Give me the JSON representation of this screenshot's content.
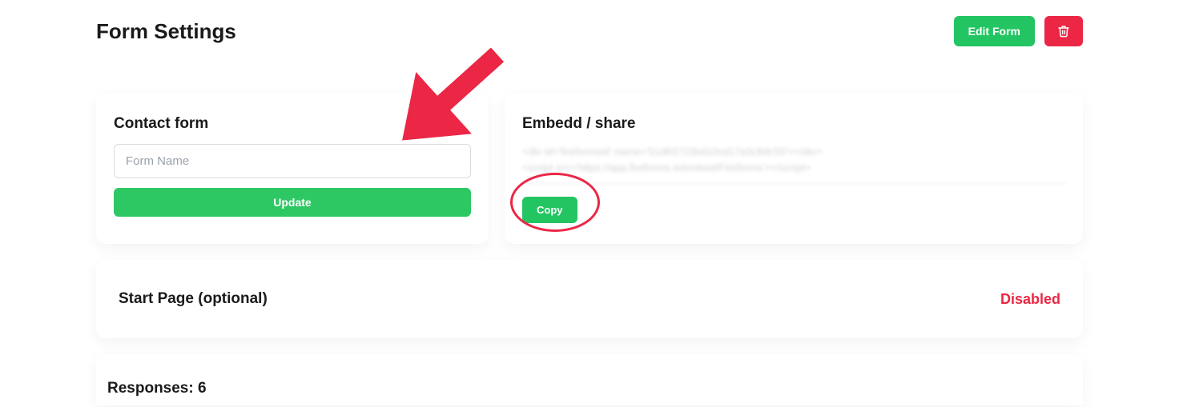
{
  "header": {
    "title": "Form Settings",
    "edit_label": "Edit Form"
  },
  "form_card": {
    "title": "Contact form",
    "input_placeholder": "Form Name",
    "input_value": "",
    "update_label": "Update"
  },
  "embed_card": {
    "title": "Embedd / share",
    "preview_line1": "<div id='fireformsid' name='51d83723bd10cd17a3c8dc55'></div>",
    "preview_line2": "<script src='https://app.fireforms.io/embed/Fireforms'></script>",
    "copy_label": "Copy"
  },
  "start_page": {
    "title": "Start Page (optional)",
    "status": "Disabled"
  },
  "responses": {
    "title": "Responses: 6"
  }
}
